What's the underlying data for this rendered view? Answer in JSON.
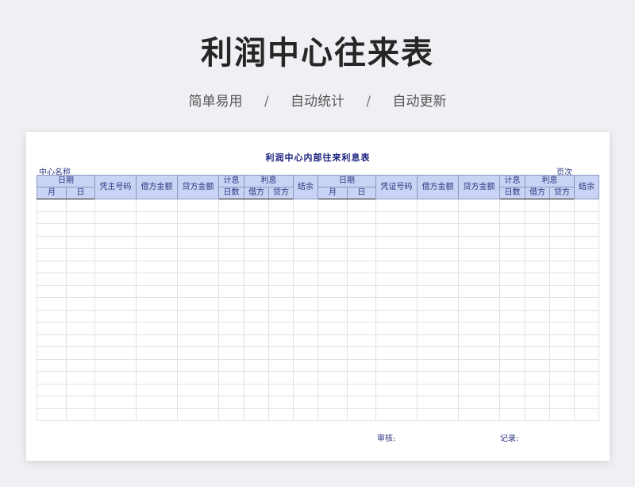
{
  "banner": {
    "title": "利润中心往来表",
    "tags": [
      "简单易用",
      "自动统计",
      "自动更新"
    ],
    "separator": "/"
  },
  "sheet": {
    "title": "利润中心内部往来利息表",
    "center_name_label": "中心名称",
    "page_label": "页次",
    "headers": {
      "date": "日期",
      "month": "月",
      "day": "日",
      "voucher_left": "凭主号码",
      "voucher_right": "凭证号码",
      "debit_amount": "借方金额",
      "credit_amount": "贷方金额",
      "interest_days_line1": "计息",
      "interest_days_line2": "日数",
      "interest": "利息",
      "interest_debit": "借方",
      "interest_credit": "贷方",
      "balance": "结余"
    },
    "empty_rows": 18,
    "footer": {
      "review_label": "审核:",
      "record_label": "记录:"
    }
  },
  "colors": {
    "header_fill": "#c9d3f3",
    "header_text": "#2d3580",
    "title_text": "#1a237e"
  }
}
